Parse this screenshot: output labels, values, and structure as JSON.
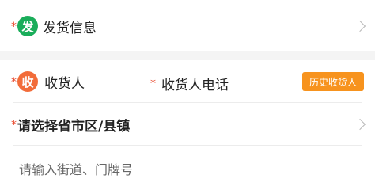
{
  "shipping_section": {
    "required_mark": "*",
    "badge_text": "发",
    "badge_color": "#1aad5a",
    "title": "发货信息",
    "chevron_icon": "chevron-right-icon"
  },
  "receiver_section": {
    "required_mark": "*",
    "badge_text": "收",
    "badge_color": "#f26c3a",
    "name_label": "收货人",
    "phone_required_mark": "*",
    "phone_label": "收货人电话",
    "history_button_label": "历史收货人",
    "history_button_color": "#f7931e",
    "region_required_mark": "*",
    "region_label": "请选择省市区/县镇",
    "street_placeholder": "请输入街道、门牌号"
  }
}
